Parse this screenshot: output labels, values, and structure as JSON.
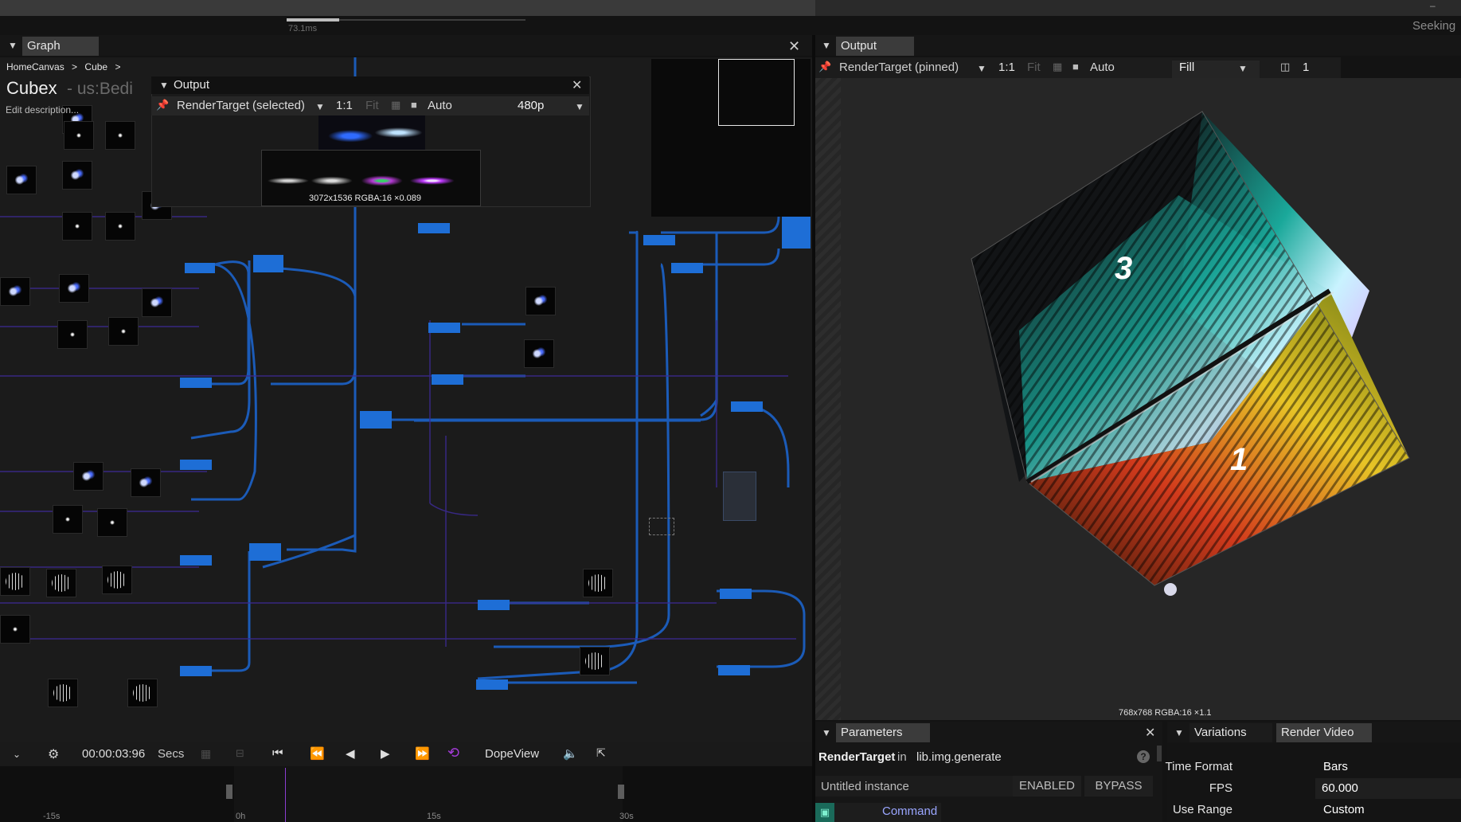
{
  "topbar": {
    "timing": "73.1ms",
    "seek_status": "Seeking",
    "minimize": "–"
  },
  "graph_panel": {
    "tab": "Graph",
    "breadcrumb": [
      "HomeCanvas",
      "Cube"
    ],
    "breadcrumb_sep": ">",
    "title": "Cubex",
    "subtitle": "- us:Bedi",
    "edit_description": "Edit description..."
  },
  "graph_output_popup": {
    "title": "Output",
    "render_target": "RenderTarget (selected)",
    "ratio": "1:1",
    "fit": "Fit",
    "auto": "Auto",
    "resolution": "480p",
    "info": "3072x1536  RGBA:16  ×0.089"
  },
  "timeline": {
    "time": "00:00:03:96",
    "units": "Secs",
    "dope_view": "DopeView",
    "ticks": [
      "-15s",
      "0h",
      "15s",
      "30s"
    ]
  },
  "output_panel": {
    "tab": "Output",
    "render_target": "RenderTarget (pinned)",
    "ratio": "1:1",
    "fit": "Fit",
    "auto": "Auto",
    "fill": "Fill",
    "snapshot_count": "1",
    "info": "768x768  RGBA:16  ×1.1",
    "cube_labels": [
      "3",
      "1"
    ]
  },
  "parameters_panel": {
    "tab": "Parameters",
    "op_name": "RenderTarget",
    "in_label": "in",
    "op_type": "lib.img.generate",
    "instance": "Untitled instance",
    "enabled": "ENABLED",
    "bypass": "BYPASS",
    "command": "Command"
  },
  "variations_panel": {
    "tabs": [
      "Variations",
      "Render Video"
    ],
    "fields": [
      {
        "label": "Time Format",
        "value": "Bars"
      },
      {
        "label": "FPS",
        "value": "60.000"
      },
      {
        "label": "Use Range",
        "value": "Custom"
      }
    ]
  },
  "colors": {
    "accent_blue": "#1e6ed6",
    "playhead": "#8b3ed1",
    "loop_icon": "#a23ad6"
  }
}
